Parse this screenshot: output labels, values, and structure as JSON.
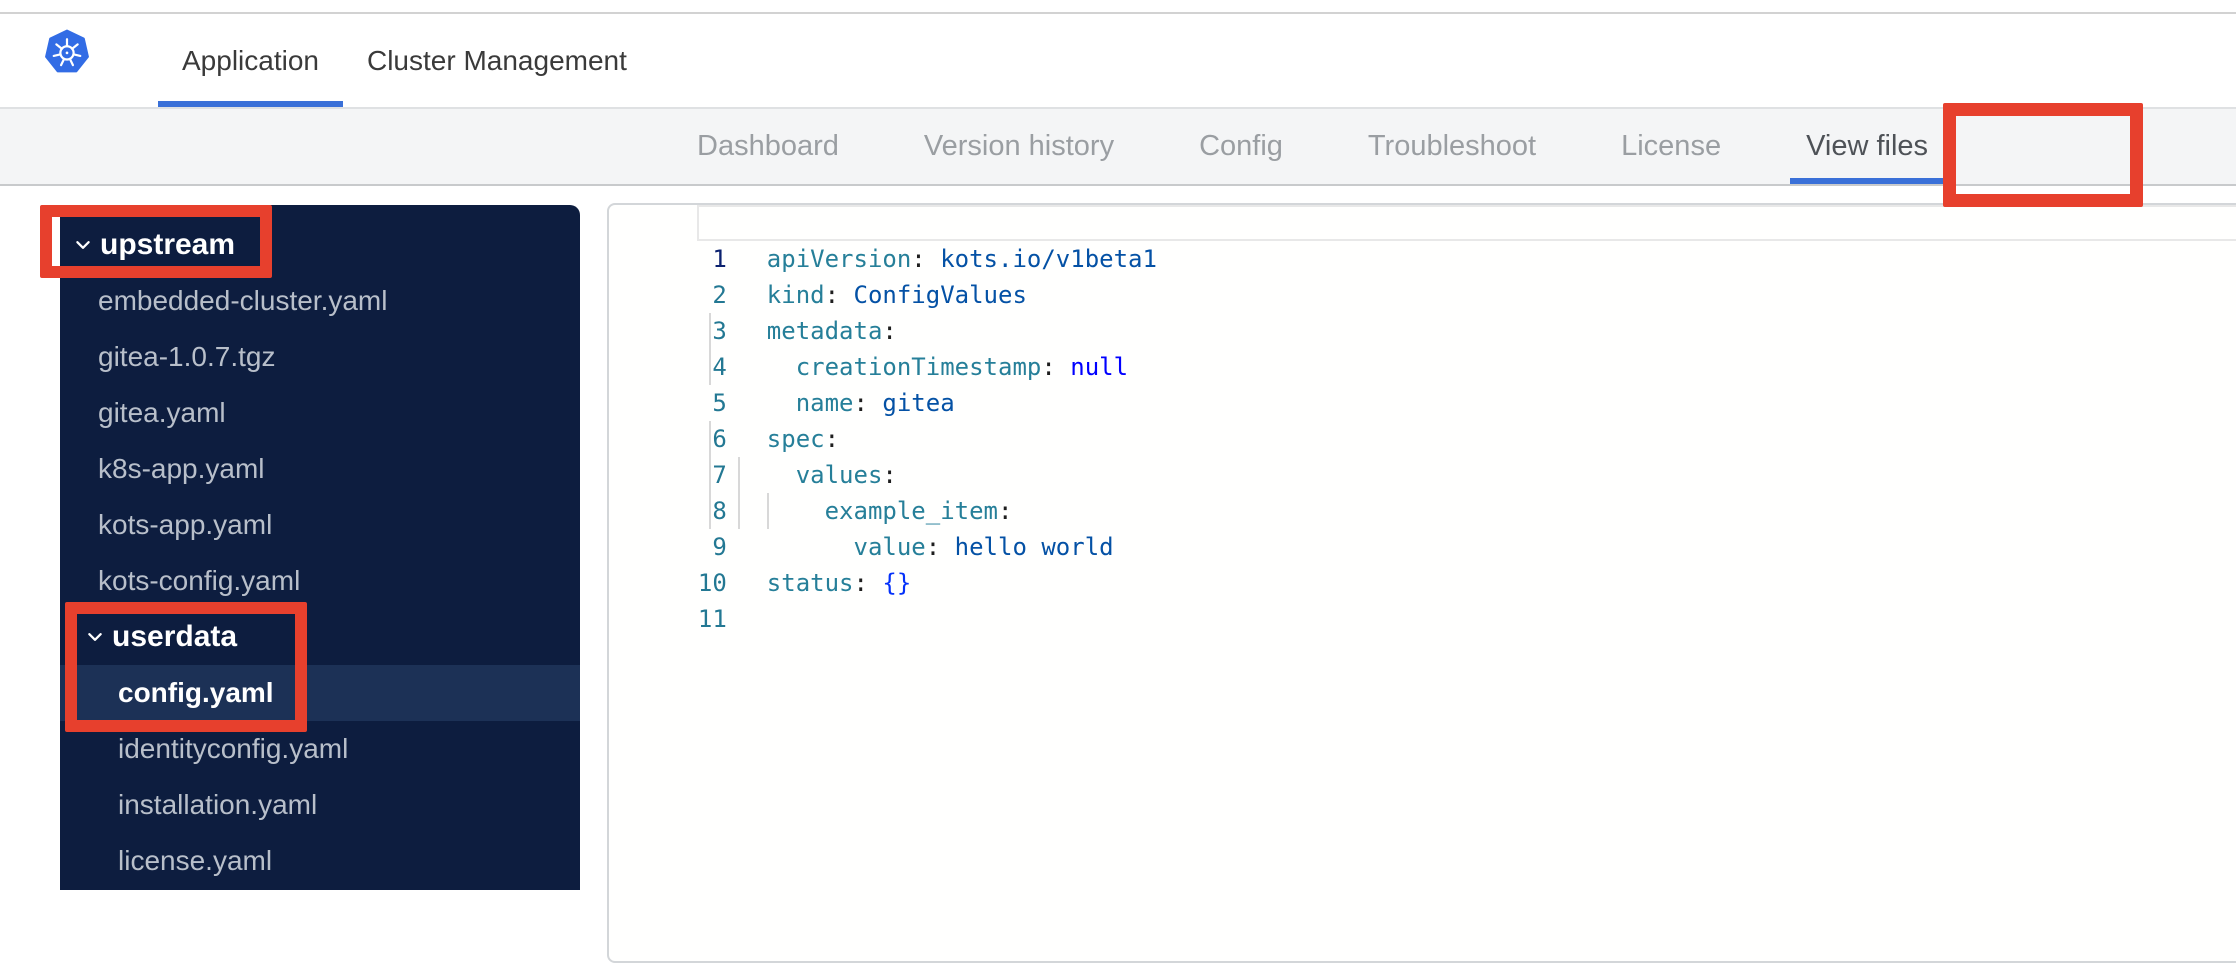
{
  "header": {
    "logo": "kubernetes-logo",
    "tabs": [
      {
        "label": "Application",
        "active": true
      },
      {
        "label": "Cluster Management",
        "active": false
      }
    ]
  },
  "nav": {
    "items": [
      {
        "label": "Dashboard",
        "active": false
      },
      {
        "label": "Version history",
        "active": false
      },
      {
        "label": "Config",
        "active": false
      },
      {
        "label": "Troubleshoot",
        "active": false
      },
      {
        "label": "License",
        "active": false
      },
      {
        "label": "View files",
        "active": true
      }
    ]
  },
  "file_tree": {
    "items": [
      {
        "type": "folder",
        "label": "upstream",
        "level": 0,
        "expanded": true,
        "selected": false
      },
      {
        "type": "file",
        "label": "embedded-cluster.yaml",
        "level": 0,
        "selected": false
      },
      {
        "type": "file",
        "label": "gitea-1.0.7.tgz",
        "level": 0,
        "selected": false
      },
      {
        "type": "file",
        "label": "gitea.yaml",
        "level": 0,
        "selected": false
      },
      {
        "type": "file",
        "label": "k8s-app.yaml",
        "level": 0,
        "selected": false
      },
      {
        "type": "file",
        "label": "kots-app.yaml",
        "level": 0,
        "selected": false
      },
      {
        "type": "file",
        "label": "kots-config.yaml",
        "level": 0,
        "selected": false
      },
      {
        "type": "folder",
        "label": "userdata",
        "level": 1,
        "expanded": true,
        "selected": false
      },
      {
        "type": "file",
        "label": "config.yaml",
        "level": 1,
        "selected": true
      },
      {
        "type": "file",
        "label": "identityconfig.yaml",
        "level": 1,
        "selected": false
      },
      {
        "type": "file",
        "label": "installation.yaml",
        "level": 1,
        "selected": false
      },
      {
        "type": "file",
        "label": "license.yaml",
        "level": 1,
        "selected": false
      }
    ]
  },
  "editor": {
    "language": "yaml",
    "active_line": 1,
    "lines": [
      {
        "number": 1,
        "guides": [],
        "tokens": [
          [
            "key",
            "apiVersion"
          ],
          [
            "punc",
            ":"
          ],
          [
            "plain",
            " "
          ],
          [
            "str",
            "kots.io/v1beta1"
          ]
        ]
      },
      {
        "number": 2,
        "guides": [],
        "tokens": [
          [
            "key",
            "kind"
          ],
          [
            "punc",
            ":"
          ],
          [
            "plain",
            " "
          ],
          [
            "str",
            "ConfigValues"
          ]
        ]
      },
      {
        "number": 3,
        "guides": [],
        "tokens": [
          [
            "key",
            "metadata"
          ],
          [
            "punc",
            ":"
          ]
        ]
      },
      {
        "number": 4,
        "guides": [
          0
        ],
        "tokens": [
          [
            "plain",
            "  "
          ],
          [
            "key",
            "creationTimestamp"
          ],
          [
            "punc",
            ":"
          ],
          [
            "plain",
            " "
          ],
          [
            "kw",
            "null"
          ]
        ]
      },
      {
        "number": 5,
        "guides": [
          0
        ],
        "tokens": [
          [
            "plain",
            "  "
          ],
          [
            "key",
            "name"
          ],
          [
            "punc",
            ":"
          ],
          [
            "plain",
            " "
          ],
          [
            "str",
            "gitea"
          ]
        ]
      },
      {
        "number": 6,
        "guides": [],
        "tokens": [
          [
            "key",
            "spec"
          ],
          [
            "punc",
            ":"
          ]
        ]
      },
      {
        "number": 7,
        "guides": [
          0
        ],
        "tokens": [
          [
            "plain",
            "  "
          ],
          [
            "key",
            "values"
          ],
          [
            "punc",
            ":"
          ]
        ]
      },
      {
        "number": 8,
        "guides": [
          0,
          2
        ],
        "tokens": [
          [
            "plain",
            "    "
          ],
          [
            "key",
            "example_item"
          ],
          [
            "punc",
            ":"
          ]
        ]
      },
      {
        "number": 9,
        "guides": [
          0,
          2,
          4
        ],
        "tokens": [
          [
            "plain",
            "      "
          ],
          [
            "key",
            "value"
          ],
          [
            "punc",
            ":"
          ],
          [
            "plain",
            " "
          ],
          [
            "str",
            "hello world"
          ]
        ]
      },
      {
        "number": 10,
        "guides": [],
        "tokens": [
          [
            "key",
            "status"
          ],
          [
            "punc",
            ":"
          ],
          [
            "plain",
            " "
          ],
          [
            "brace",
            "{}"
          ]
        ]
      },
      {
        "number": 11,
        "guides": [],
        "tokens": []
      }
    ]
  },
  "annotations": {
    "description": "red highlight boxes drawn over the screenshot",
    "targets": [
      "view-files-tab",
      "upstream-folder",
      "userdata-folder-and-config-yaml"
    ]
  },
  "colors": {
    "red": "#e7402d",
    "blue": "#3a70d8",
    "k8s-blue": "#326ce5",
    "sidebar-bg": "#0d1d3f",
    "sidebar-selected": "#1c3156",
    "tk-key": "#267f99",
    "tk-str": "#0451a5",
    "tk-kw": "#0000ff",
    "tk-brace": "#0431fa",
    "ln": "#237893",
    "ln-active": "#0b216f"
  }
}
